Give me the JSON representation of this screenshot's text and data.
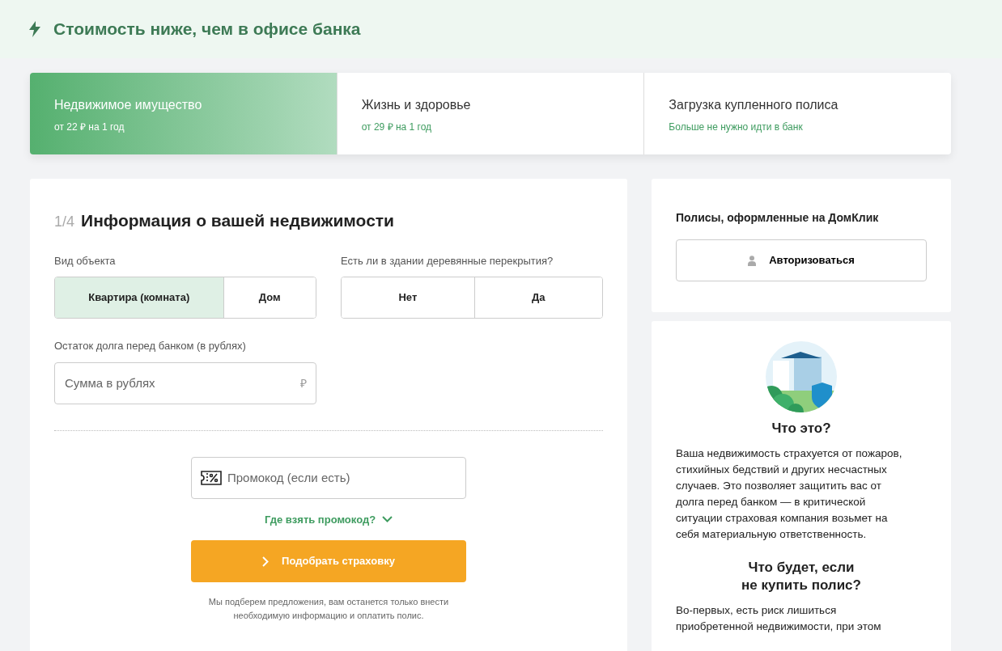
{
  "banner": {
    "text": "Стоимость ниже, чем в офисе банка"
  },
  "tabs": [
    {
      "title": "Недвижимое имущество",
      "subtitle": "от 22 ₽ на 1 год",
      "selected": true
    },
    {
      "title": "Жизнь и здоровье",
      "subtitle": "от 29 ₽ на 1 год",
      "selected": false
    },
    {
      "title": "Загрузка купленного полиса",
      "subtitle": "Больше не нужно идти в банк",
      "selected": false
    }
  ],
  "form": {
    "step": "1/4",
    "title": "Информация о вашей недвижимости",
    "object_type": {
      "label": "Вид объекта",
      "options": [
        {
          "label": "Квартира (комната)",
          "selected": true
        },
        {
          "label": "Дом",
          "selected": false
        }
      ]
    },
    "wooden_floors": {
      "label": "Есть ли в здании деревянные перекрытия?",
      "options": [
        {
          "label": "Нет",
          "selected": false
        },
        {
          "label": "Да",
          "selected": false
        }
      ]
    },
    "debt": {
      "label": "Остаток долга перед банком (в рублях)",
      "placeholder": "Сумма в рублях",
      "currency": "₽"
    },
    "promo": {
      "placeholder": "Промокод (если есть)"
    },
    "promo_help": "Где взять промокод?",
    "submit": "Подобрать страховку",
    "note": "Мы подберем предложения, вам останется только внести необходимую информацию и оплатить полис."
  },
  "policies": {
    "title": "Полисы, оформленные на ДомКлик",
    "button": "Авторизоваться"
  },
  "info": {
    "sections": [
      {
        "heading": "Что это?",
        "text": "Ваша недвижимость страхуется от пожаров, стихийных бедствий и других несчастных случаев. Это позволяет защитить вас от долга перед банком — в критической ситуации страховая компания возьмет на себя материальную ответственность."
      },
      {
        "heading": "Что будет, если не купить полис?",
        "text": "Во-первых, есть риск лишиться приобретенной недвижимости, при этом"
      }
    ]
  }
}
